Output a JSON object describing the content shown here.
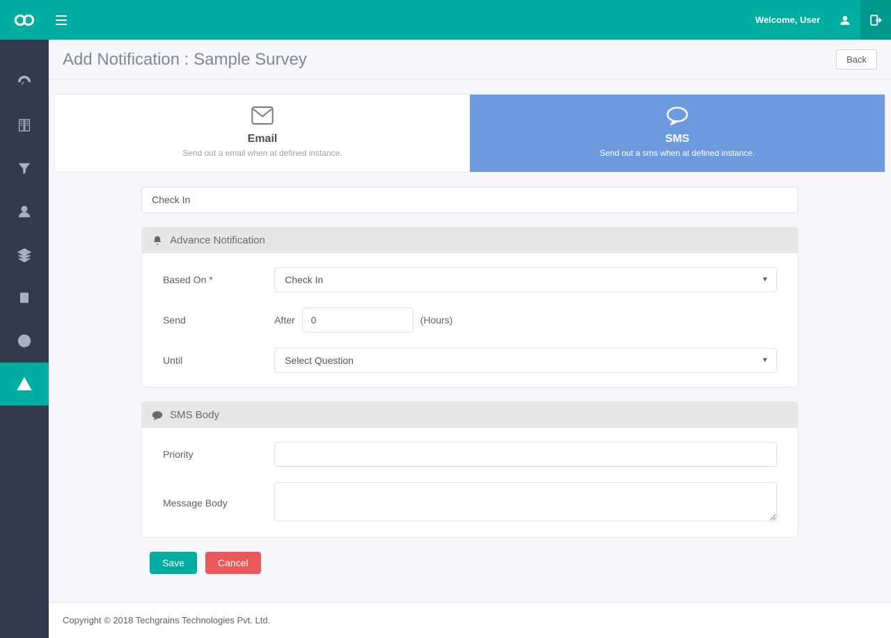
{
  "header": {
    "welcome": "Welcome, User"
  },
  "page": {
    "title": "Add Notification : Sample Survey",
    "back": "Back"
  },
  "tabs": {
    "email": {
      "title": "Email",
      "sub": "Send out a email when at defined instance."
    },
    "sms": {
      "title": "SMS",
      "sub": "Send out a sms when at defined instance."
    }
  },
  "form": {
    "name_value": "Check In",
    "advance_header": "Advance Notification",
    "based_on_label": "Based On *",
    "based_on_value": "Check In",
    "send_label": "Send",
    "send_prefix": "After",
    "send_value": "0",
    "send_suffix": "(Hours)",
    "until_label": "Until",
    "until_value": "Select Question",
    "sms_header": "SMS Body",
    "priority_label": "Priority",
    "priority_value": "",
    "body_label": "Message Body",
    "body_value": ""
  },
  "actions": {
    "save": "Save",
    "cancel": "Cancel"
  },
  "footer": {
    "copyright": "Copyright © 2018 Techgrains Technologies Pvt. Ltd."
  }
}
